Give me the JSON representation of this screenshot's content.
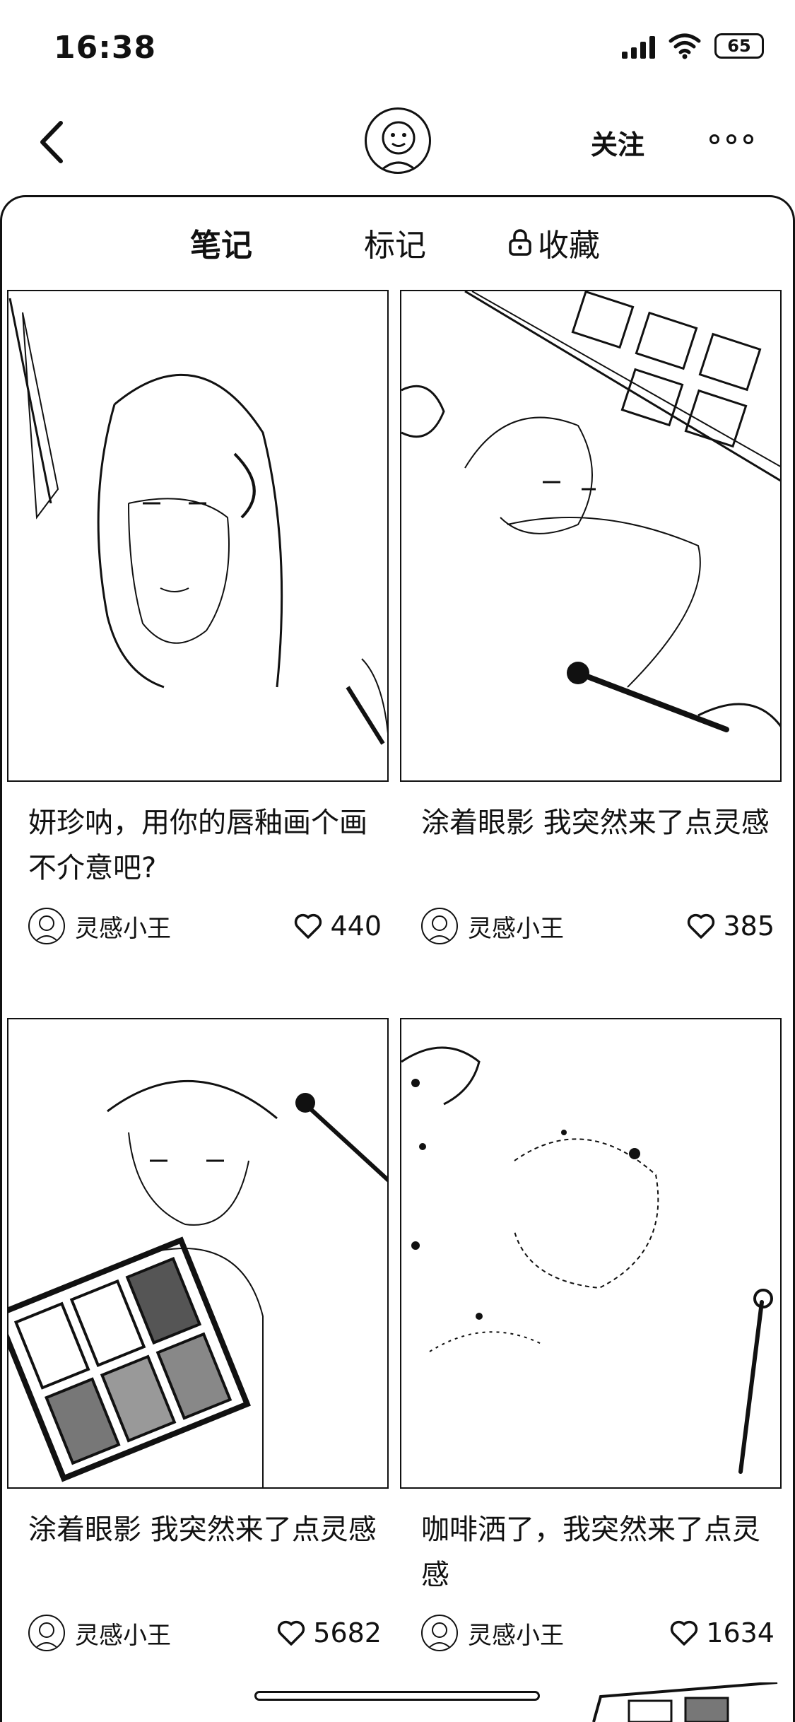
{
  "status_bar": {
    "time": "16:38",
    "battery": "65",
    "icons": [
      "signal-icon",
      "wifi-icon",
      "battery-icon"
    ]
  },
  "nav": {
    "follow_label": "关注",
    "icons": [
      "back-icon",
      "avatar",
      "more-icon"
    ]
  },
  "tabs": [
    {
      "label": "笔记",
      "active": true
    },
    {
      "label": "标记",
      "active": false
    },
    {
      "label": "收藏",
      "active": false,
      "icon": "lock-icon"
    }
  ],
  "cards": [
    {
      "title": "妍珍呐，用你的唇釉画个画不介意吧?",
      "author": "灵感小王",
      "likes": "440"
    },
    {
      "title": "涂着眼影 我突然来了点灵感",
      "author": "灵感小王",
      "likes": "385"
    },
    {
      "title": "涂着眼影 我突然来了点灵感",
      "author": "灵感小王",
      "likes": "5682"
    },
    {
      "title": "咖啡洒了，我突然来了点灵感",
      "author": "灵感小王",
      "likes": "1634"
    }
  ]
}
